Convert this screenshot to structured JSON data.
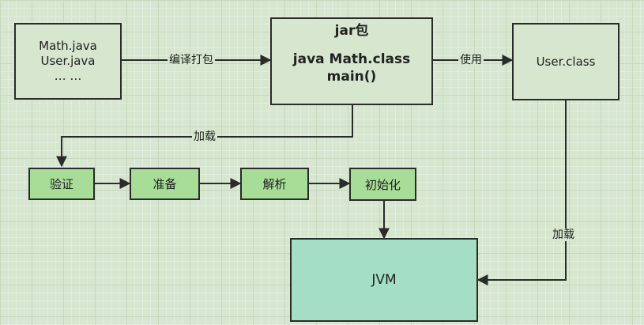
{
  "source_box": {
    "lines": [
      "Math.java",
      "User.java",
      "… …"
    ]
  },
  "jar_box": {
    "title": "jar包",
    "line1": "java Math.class",
    "line2": "main()"
  },
  "user_class_box": {
    "label": "User.class"
  },
  "edges": {
    "compile": "编译打包",
    "use": "使用",
    "load_left": "加载",
    "load_right": "加载"
  },
  "steps": [
    "验证",
    "准备",
    "解析",
    "初始化"
  ],
  "jvm_box": {
    "label": "JVM"
  },
  "colors": {
    "background": "#d6e6cf",
    "step_fill": "#a7dd96",
    "jvm_fill": "#a4dfc5",
    "stroke": "#2b2b2b"
  }
}
